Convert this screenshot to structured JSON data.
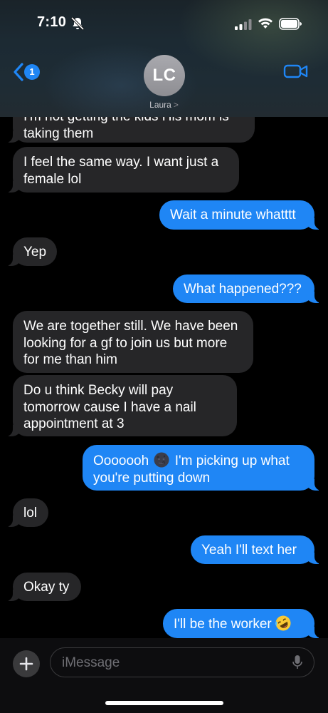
{
  "status_bar": {
    "time": "7:10"
  },
  "header": {
    "back_badge": "1",
    "avatar_initials": "LC",
    "contact_name": "Laura",
    "contact_chevron": ">"
  },
  "messages": [
    {
      "from": "them",
      "text": "I'm not getting the kids  His mom is taking them"
    },
    {
      "from": "them",
      "text": "I feel the same way. I want just a female lol"
    },
    {
      "from": "me",
      "text": "Wait a minute whatttt"
    },
    {
      "from": "them",
      "text": "Yep"
    },
    {
      "from": "me",
      "text": "What happened???"
    },
    {
      "from": "them",
      "text": "We are together still. We have been looking for a gf to join us but more for me than him"
    },
    {
      "from": "them",
      "text": "Do u think Becky will pay tomorrow cause I have a nail appointment at 3"
    },
    {
      "from": "me",
      "text": "Ooooooh",
      "emoji": "new-moon-face-emoji",
      "text_after": " I'm picking up what you're putting down"
    },
    {
      "from": "them",
      "text": "lol"
    },
    {
      "from": "me",
      "text": "Yeah I'll text her"
    },
    {
      "from": "them",
      "text": "Okay ty"
    },
    {
      "from": "me",
      "text": "I'll be the worker ",
      "emoji": "rolling-on-floor-laughing-emoji"
    }
  ],
  "input": {
    "placeholder": "iMessage"
  },
  "colors": {
    "outgoing": "#1f86f5",
    "incoming": "#262628",
    "background": "#000000"
  }
}
